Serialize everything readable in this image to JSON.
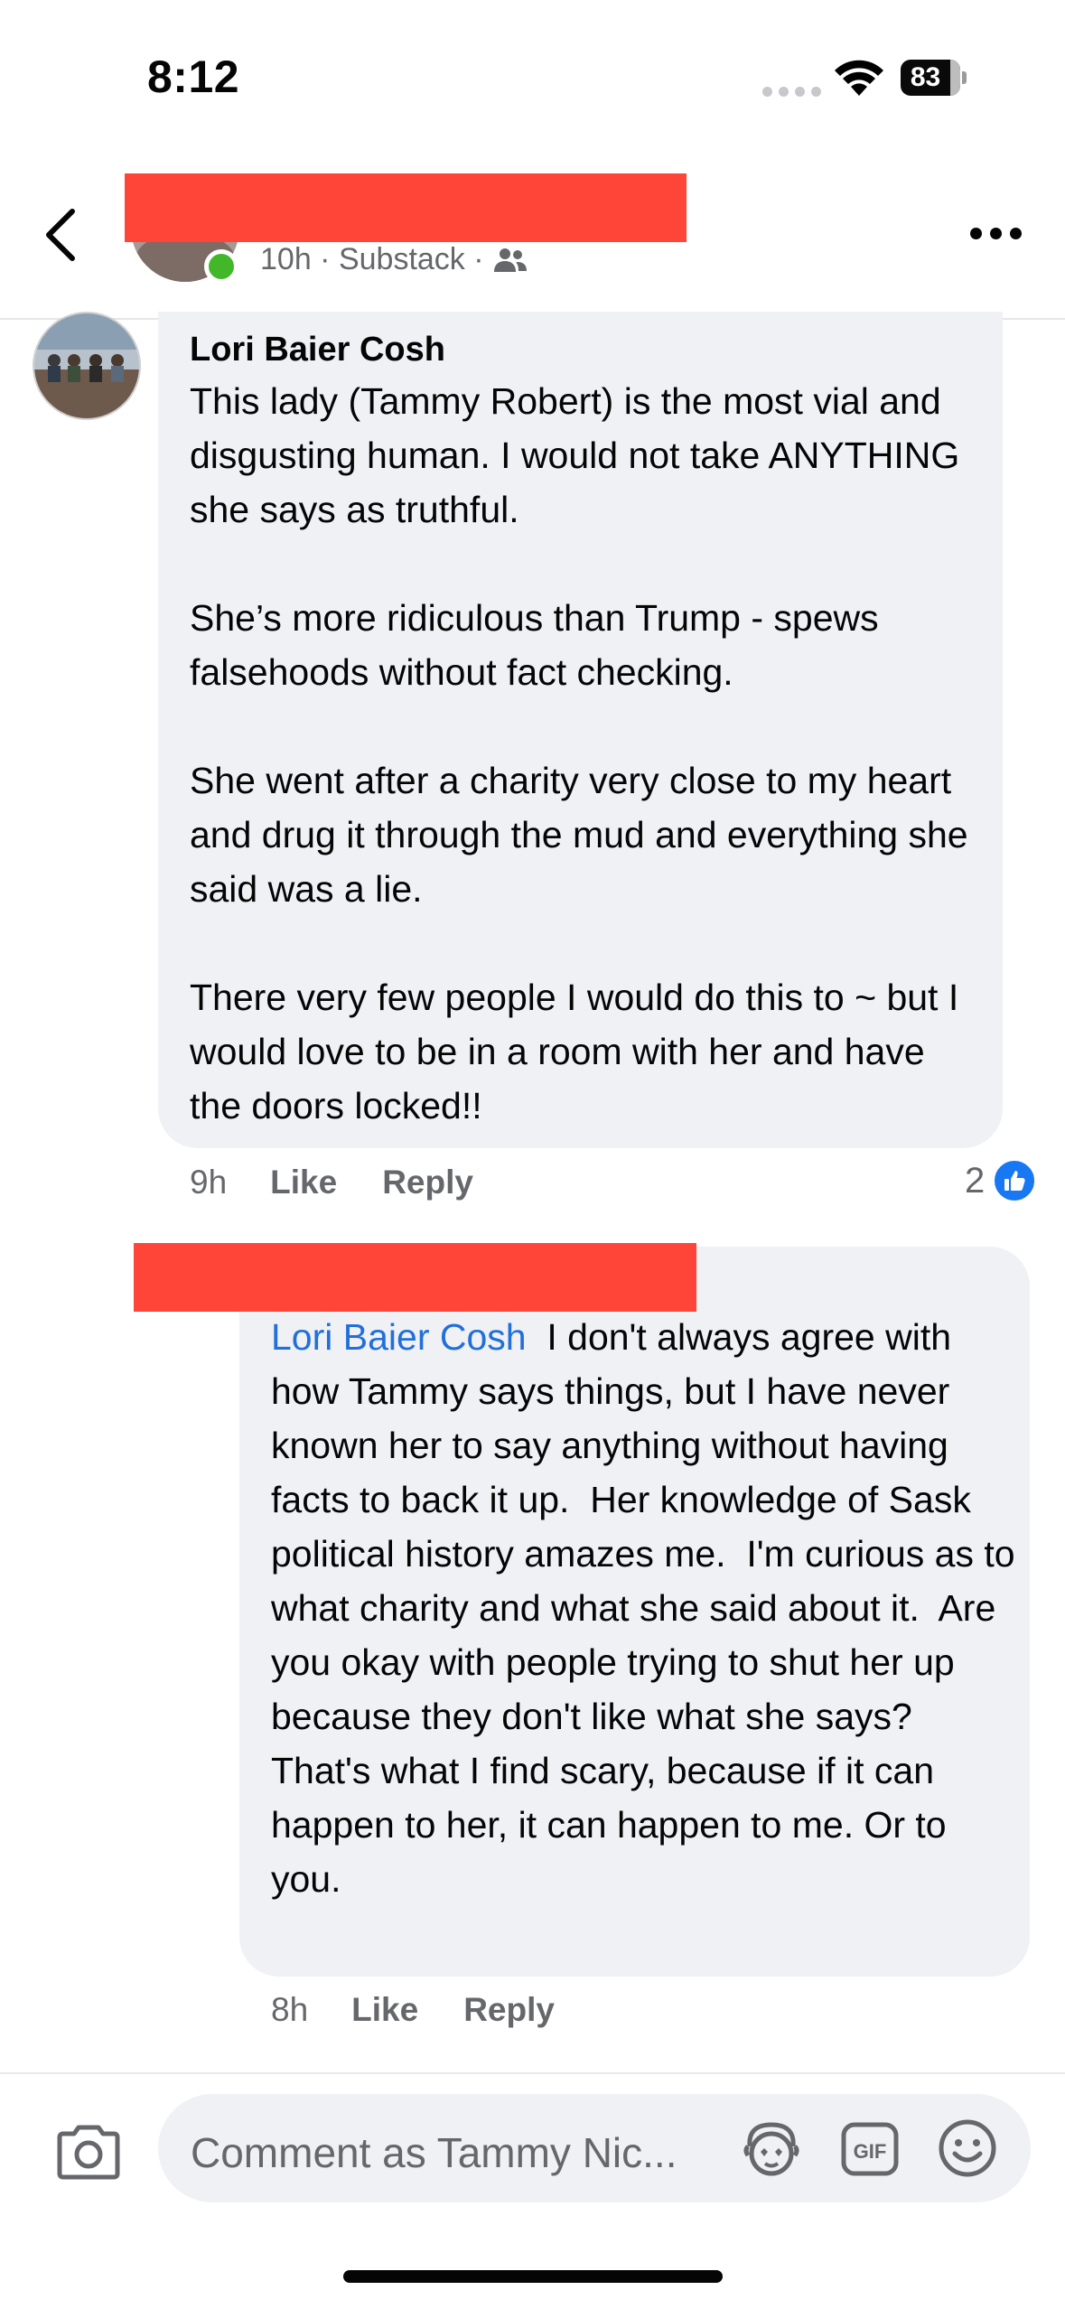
{
  "status_bar": {
    "time": "8:12",
    "battery": "83"
  },
  "header": {
    "meta": "10h · Substack ·",
    "icons": [
      "back-arrow-icon",
      "friends-icon",
      "more-icon"
    ]
  },
  "comments": [
    {
      "author": "Lori Baier Cosh",
      "text": "This lady (Tammy Robert) is the most vial and disgusting human. I would not take ANYTHING she says as truthful.\n\nShe’s more ridiculous than Trump - spews falsehoods without fact checking.\n\nShe went after a charity very close to my heart and drug it through the mud and everything she said was a lie.\n\nThere very few people I would do this to ~ but I would love to be in a room with her and have the doors locked!!",
      "time": "9h",
      "like_label": "Like",
      "reply_label": "Reply",
      "reaction_count": "2"
    },
    {
      "mention": "Lori Baier Cosh",
      "text": "  I don't always agree with how Tammy says things, but I have never known her to say anything without having facts to back it up.  Her knowledge of Sask political history amazes me.  I'm curious as to what charity and what she said about it.  Are you okay with people trying to shut her up because they don't like what she says? That's what I find scary, because if it can happen to her, it can happen to me. Or to you.",
      "time": "8h",
      "like_label": "Like",
      "reply_label": "Reply"
    }
  ],
  "composer": {
    "placeholder": "Comment as Tammy Nic...",
    "icons": [
      "camera-icon",
      "avatar-sticker-icon",
      "gif-icon",
      "emoji-icon"
    ]
  },
  "colors": {
    "redaction": "#ff4438",
    "bubble": "#eff1f5",
    "mention": "#216fdb",
    "like_blue": "#1877f2",
    "online": "#42b72a"
  }
}
